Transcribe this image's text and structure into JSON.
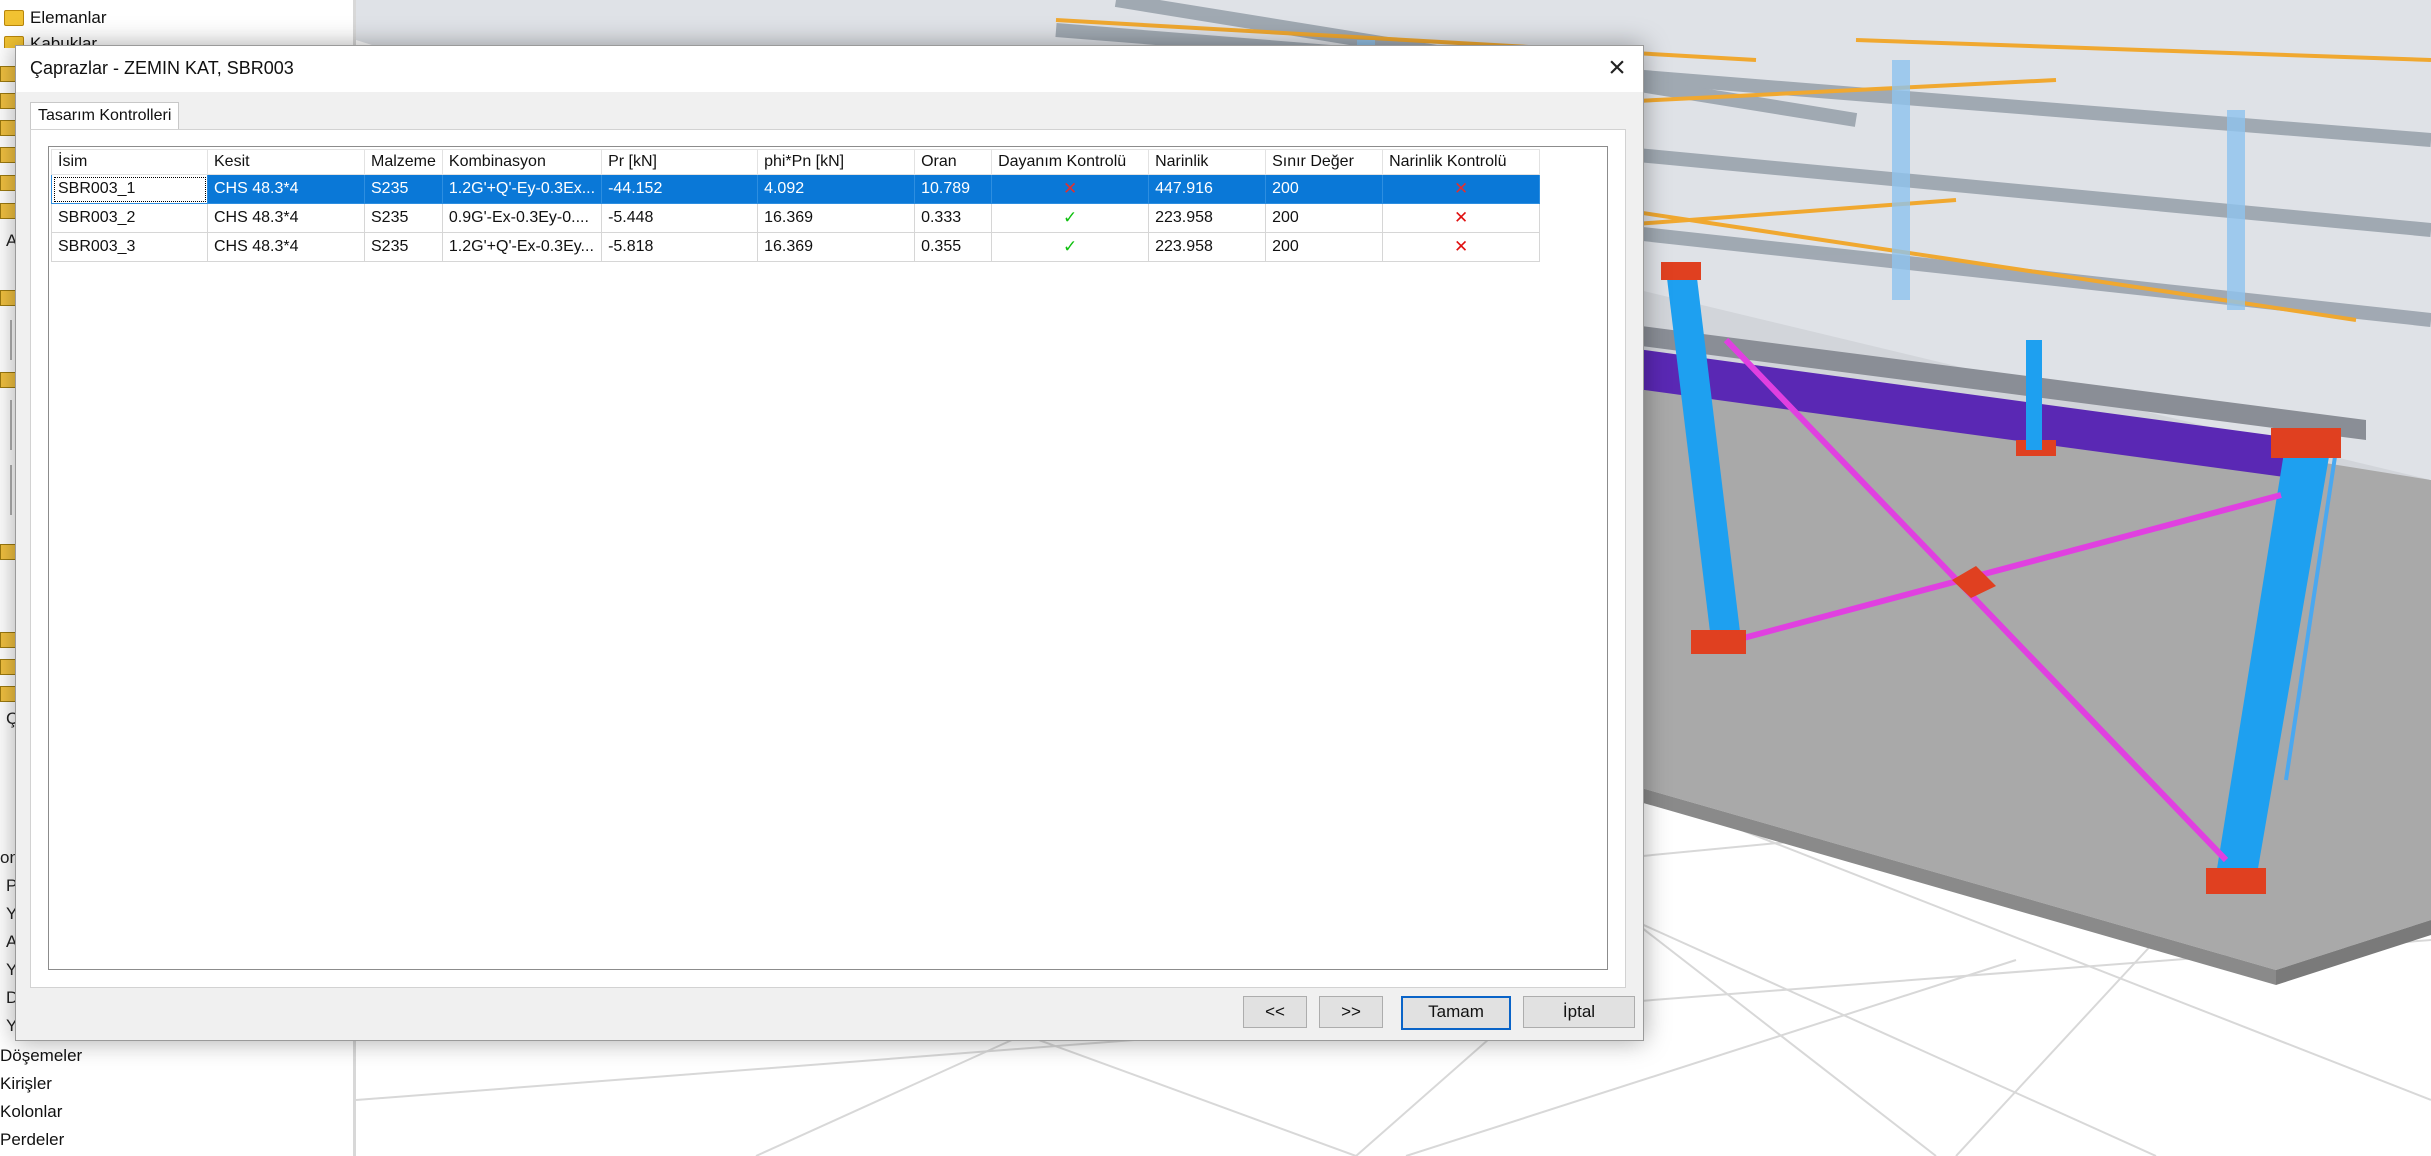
{
  "tree": {
    "top_items": [
      "Elemanlar",
      "Kabuklar"
    ],
    "fragments": [
      "A",
      "Ç",
      "on",
      "P",
      "Y",
      "A",
      "Y",
      "D",
      "Y"
    ],
    "bottom_items": [
      "Döşemeler",
      "Kirişler",
      "Kolonlar",
      "Perdeler"
    ]
  },
  "dialog": {
    "title": "Çaprazlar - ZEMIN KAT, SBR003",
    "close_icon": "×",
    "tab_label": "Tasarım Kontrolleri",
    "columns": [
      "İsim",
      "Kesit",
      "Malzeme",
      "Kombinasyon",
      "Pr [kN]",
      "phi*Pn [kN]",
      "Oran",
      "Dayanım Kontrolü",
      "Narinlik",
      "Sınır Değer",
      "Narinlik Kontrolü"
    ],
    "rows": [
      {
        "isim": "SBR003_1",
        "kesit": "CHS 48.3*4",
        "malzeme": "S235",
        "kombinasyon": "1.2G'+Q'-Ey-0.3Ex...",
        "pr": "-44.152",
        "phipn": "4.092",
        "oran": "10.789",
        "dayanim": "✕",
        "narinlik": "447.916",
        "sinir": "200",
        "narinlik_kontrol": "✕"
      },
      {
        "isim": "SBR003_2",
        "kesit": "CHS 48.3*4",
        "malzeme": "S235",
        "kombinasyon": "0.9G'-Ex-0.3Ey-0....",
        "pr": "-5.448",
        "phipn": "16.369",
        "oran": "0.333",
        "dayanim": "✓",
        "narinlik": "223.958",
        "sinir": "200",
        "narinlik_kontrol": "✕"
      },
      {
        "isim": "SBR003_3",
        "kesit": "CHS 48.3*4",
        "malzeme": "S235",
        "kombinasyon": "1.2G'+Q'-Ex-0.3Ey...",
        "pr": "-5.818",
        "phipn": "16.369",
        "oran": "0.355",
        "dayanim": "✓",
        "narinlik": "223.958",
        "sinir": "200",
        "narinlik_kontrol": "✕"
      }
    ],
    "buttons": {
      "prev": "<<",
      "next": ">>",
      "ok": "Tamam",
      "cancel": "İptal"
    }
  },
  "colors": {
    "selection": "#0a78d7",
    "pass": "#10c010",
    "fail": "#e01010",
    "column_blue": "#1ea0f0",
    "beam_purple": "#5a28b4",
    "brace_magenta": "#e040e0",
    "base_plate_red": "#e04020"
  },
  "icons": {
    "folder": "folder-icon",
    "close": "close-icon",
    "pass": "check-icon",
    "fail": "cross-icon"
  }
}
